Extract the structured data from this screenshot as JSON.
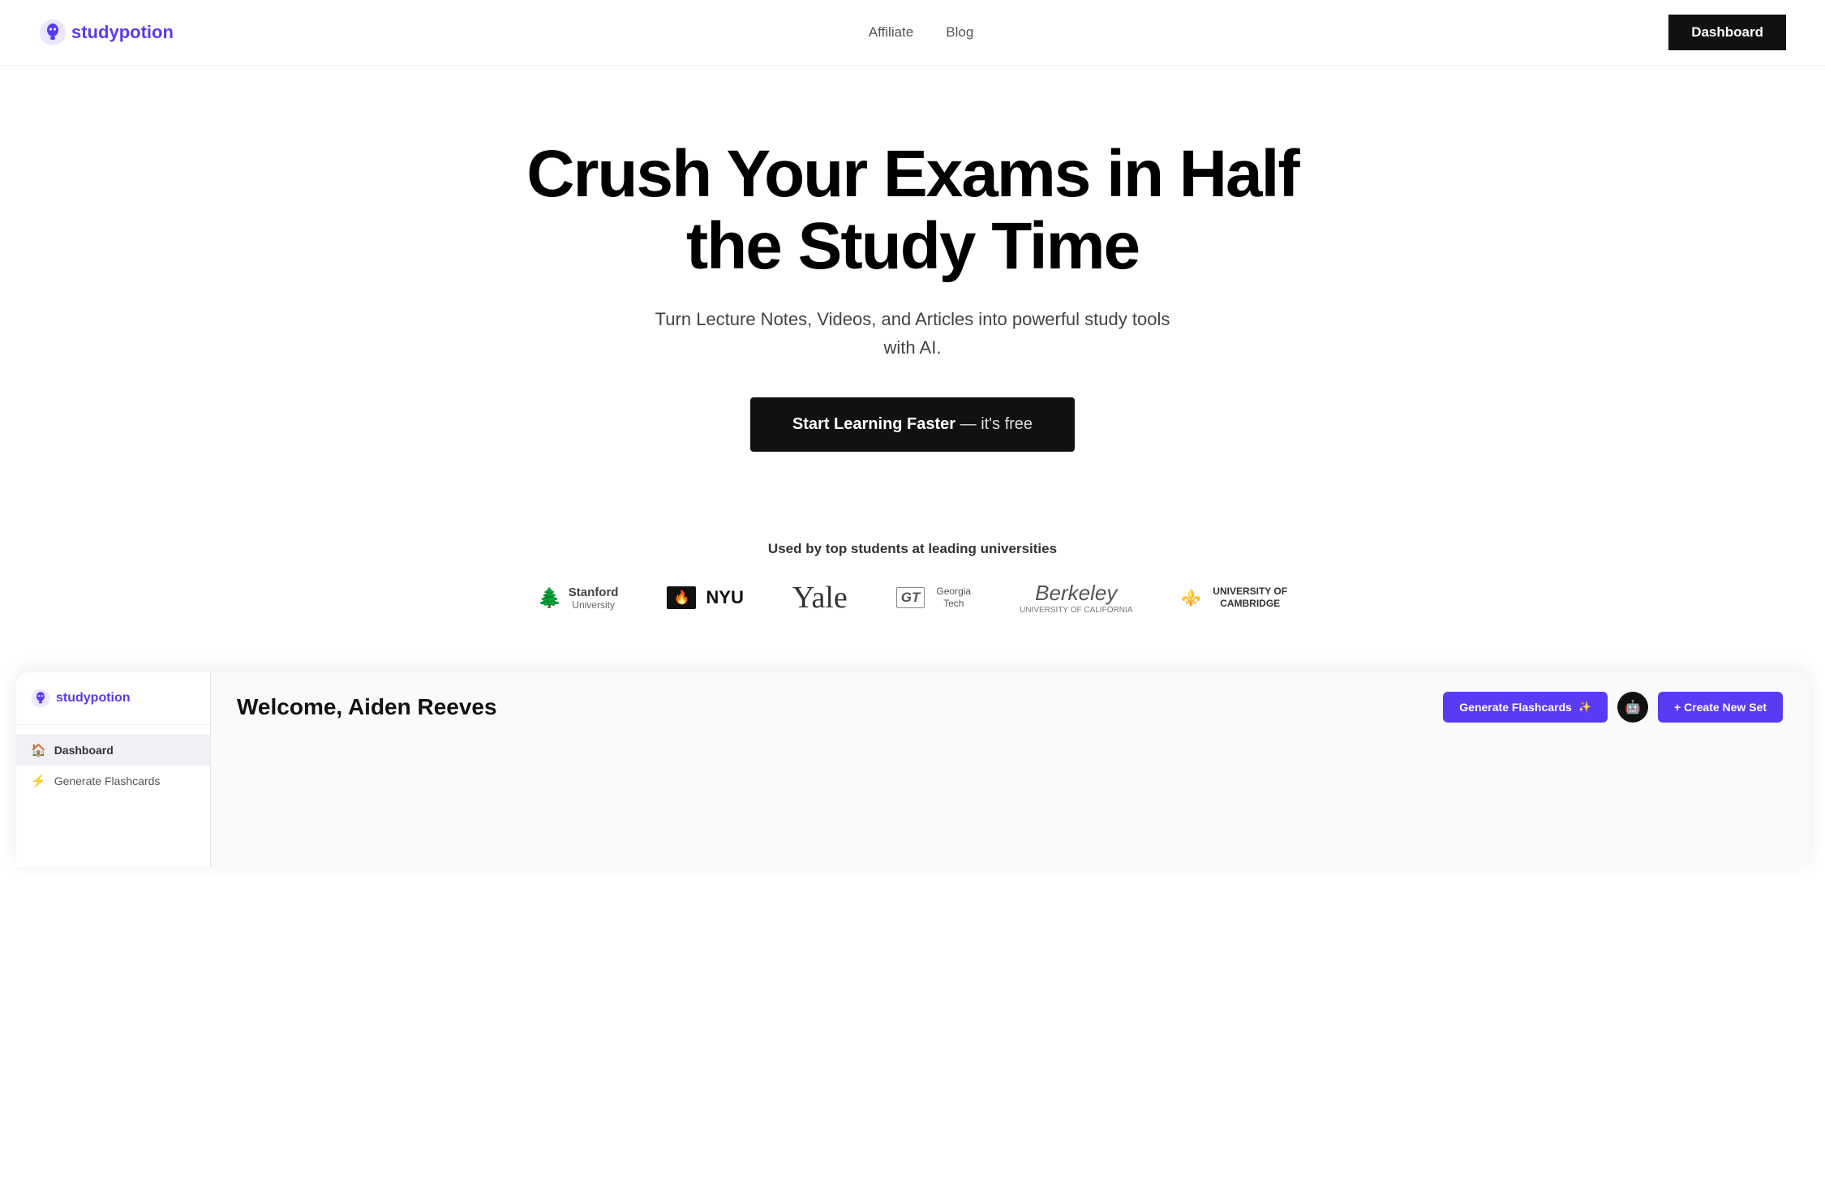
{
  "nav": {
    "logo_text_start": "study",
    "logo_text_end": "potion",
    "links": [
      {
        "label": "Affiliate",
        "href": "#"
      },
      {
        "label": "Blog",
        "href": "#"
      }
    ],
    "dashboard_btn": "Dashboard"
  },
  "hero": {
    "title_line1": "Crush Your Exams in Half",
    "title_line2": "the Study Time",
    "subtitle": "Turn Lecture Notes, Videos, and Articles into powerful study tools\nwith AI.",
    "cta_label": "Start Learning Faster",
    "cta_suffix": "— it's free"
  },
  "social_proof": {
    "heading": "Used by top students at leading universities",
    "universities": [
      {
        "name": "Stanford\nUniversity",
        "style": "stanford"
      },
      {
        "name": "NYU",
        "style": "nyu"
      },
      {
        "name": "Yale",
        "style": "yale"
      },
      {
        "name": "Georgia\nTech",
        "style": "gt"
      },
      {
        "name": "Berkeley\nUniversity of California",
        "style": "berkeley"
      },
      {
        "name": "UNIVERSITY OF\nCAMBRIDGE",
        "style": "cambridge"
      }
    ]
  },
  "dashboard": {
    "sidebar": {
      "logo_start": "study",
      "logo_end": "potion",
      "nav_items": [
        {
          "label": "Dashboard",
          "icon": "🏠",
          "active": true
        },
        {
          "label": "Generate Flashcards",
          "icon": "⚡",
          "active": false
        }
      ]
    },
    "welcome": "Welcome, Aiden Reeves",
    "generate_btn": "Generate Flashcards",
    "create_btn": "+ Create New Set"
  }
}
